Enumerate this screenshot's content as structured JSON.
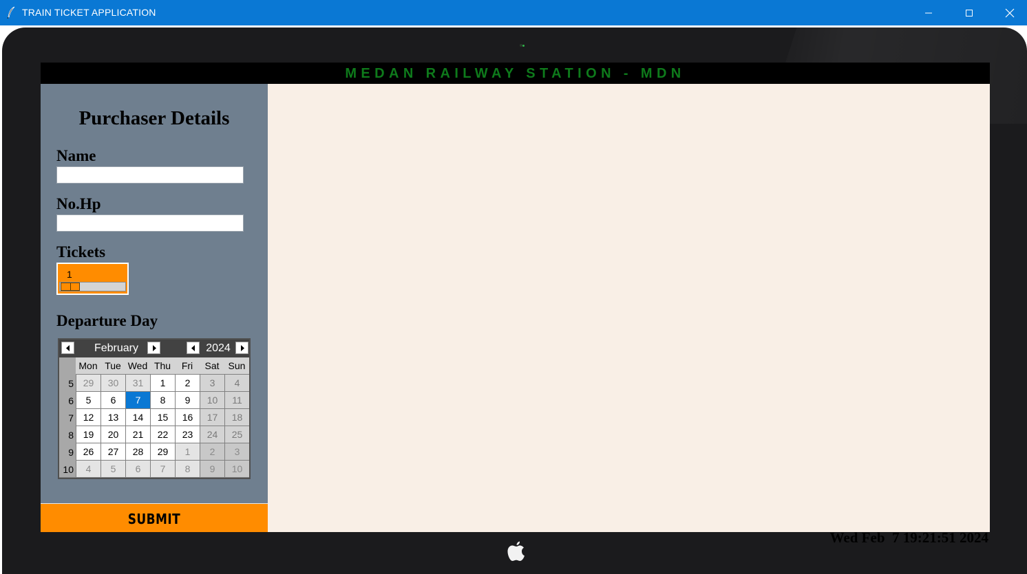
{
  "window": {
    "title": "TRAIN TICKET APPLICATION",
    "icons": [
      "feather-icon",
      "minimize-icon",
      "maximize-icon",
      "close-icon"
    ]
  },
  "header": {
    "station": "MEDAN RAILWAY STATION - MDN",
    "color": "#0e7a1b"
  },
  "sidebar": {
    "title": "Purchaser Details",
    "name_label": "Name",
    "name_value": "",
    "phone_label": "No.Hp",
    "phone_value": "",
    "tickets_label": "Tickets",
    "tickets_value": "1",
    "departure_label": "Departure Day",
    "accent": "#ff8c00",
    "background": "#6f7f8f"
  },
  "calendar": {
    "month": "February",
    "year": "2024",
    "weekdays": [
      "Mon",
      "Tue",
      "Wed",
      "Thu",
      "Fri",
      "Sat",
      "Sun"
    ],
    "weeks": [
      {
        "num": "5",
        "days": [
          "29",
          "30",
          "31",
          "1",
          "2",
          "3",
          "4"
        ]
      },
      {
        "num": "6",
        "days": [
          "5",
          "6",
          "7",
          "8",
          "9",
          "10",
          "11"
        ]
      },
      {
        "num": "7",
        "days": [
          "12",
          "13",
          "14",
          "15",
          "16",
          "17",
          "18"
        ]
      },
      {
        "num": "8",
        "days": [
          "19",
          "20",
          "21",
          "22",
          "23",
          "24",
          "25"
        ]
      },
      {
        "num": "9",
        "days": [
          "26",
          "27",
          "28",
          "29",
          "1",
          "2",
          "3"
        ]
      },
      {
        "num": "10",
        "days": [
          "4",
          "5",
          "6",
          "7",
          "8",
          "9",
          "10"
        ]
      }
    ],
    "selected_day": "7",
    "selected_color": "#0a78d4"
  },
  "submit": {
    "label": "SUBMIT"
  },
  "status": {
    "clock": "Wed Feb  7 19:21:51 2024"
  }
}
